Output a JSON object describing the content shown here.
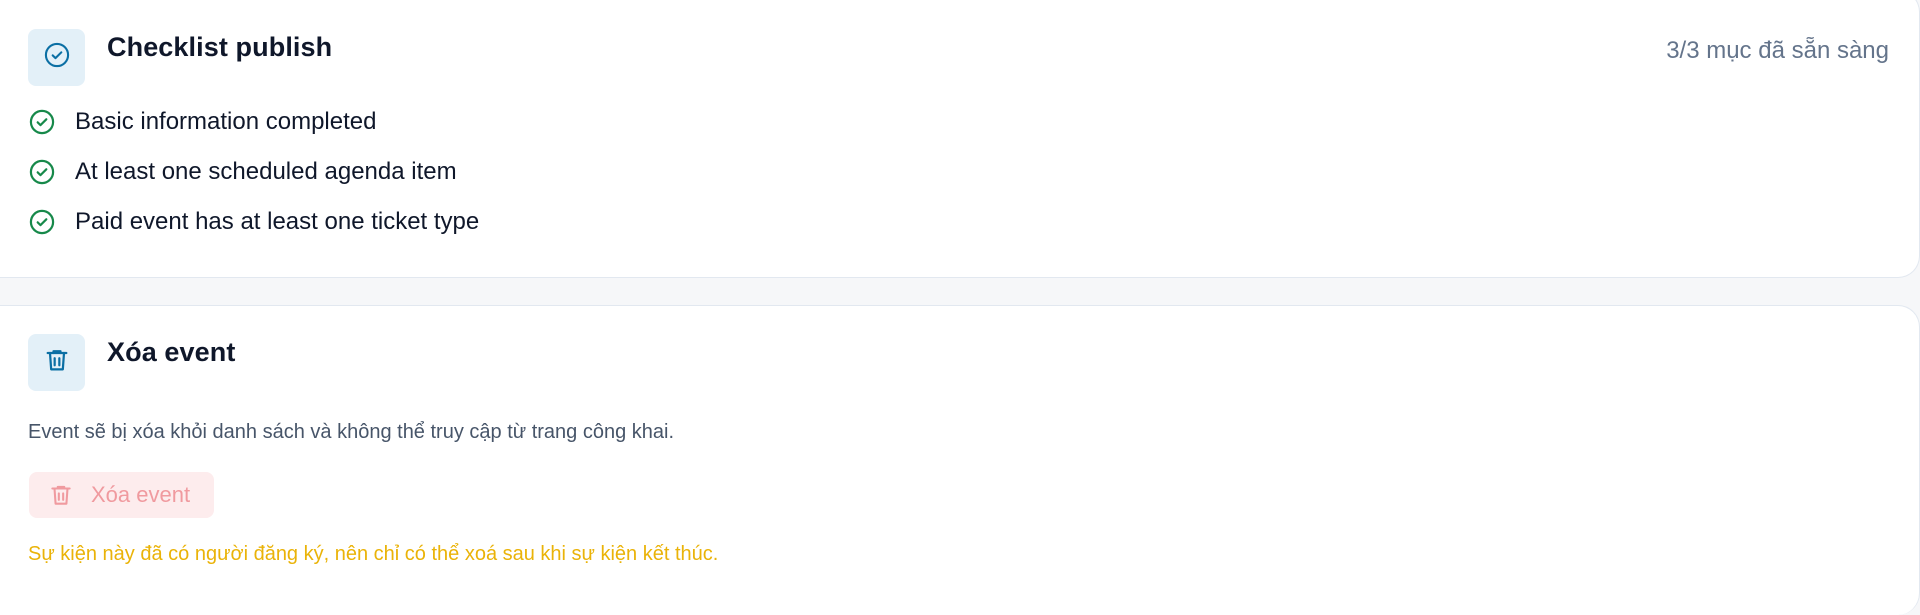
{
  "checklist": {
    "title": "Checklist publish",
    "status": "3/3 mục đã sẵn sàng",
    "items": [
      {
        "label": "Basic information completed",
        "done": true
      },
      {
        "label": "At least one scheduled agenda item",
        "done": true
      },
      {
        "label": "Paid event has at least one ticket type",
        "done": true
      }
    ]
  },
  "delete_event": {
    "title": "Xóa event",
    "description": "Event sẽ bị xóa khỏi danh sách và không thể truy cập từ trang công khai.",
    "button_label": "Xóa event",
    "button_disabled": true,
    "warning": "Sự kiện này đã có người đăng ký, nên chỉ có thể xoá sau khi sự kiện kết thúc."
  },
  "icons": {
    "checklist_header": "check-circle-icon",
    "check_item": "check-circle-icon",
    "delete_header": "trash-icon",
    "delete_button": "trash-icon"
  },
  "colors": {
    "accent_blue": "#0b6fa4",
    "success_green": "#17894a",
    "danger_disabled_text": "#f09a9f",
    "danger_disabled_bg": "#fdeced",
    "warning_text": "#eab308",
    "muted_text": "#64748b"
  }
}
